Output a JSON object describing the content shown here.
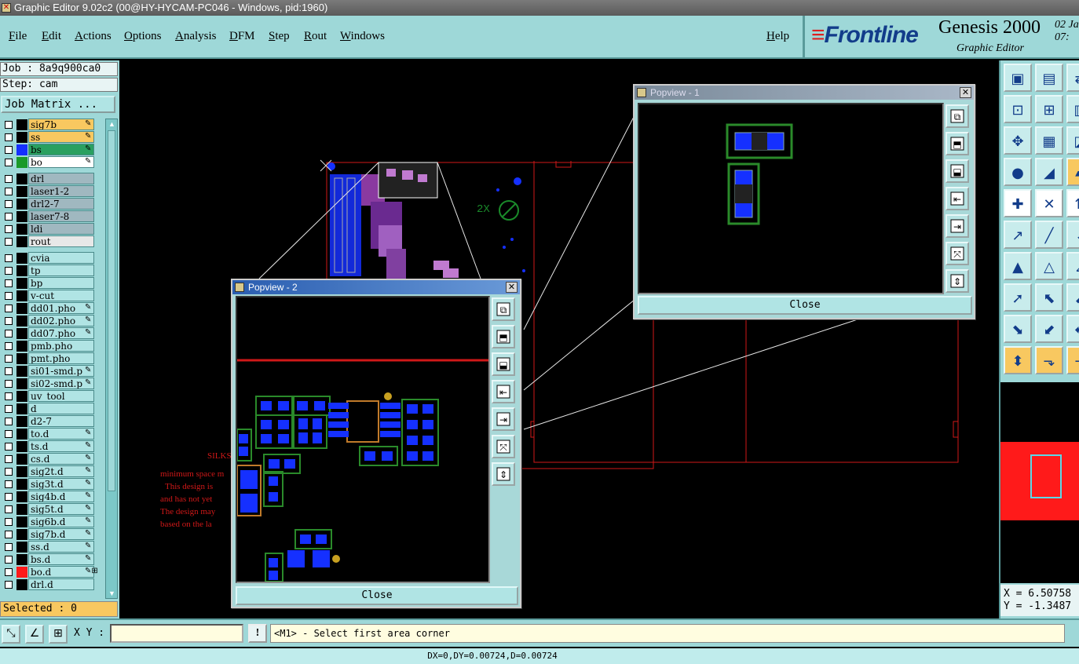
{
  "window": {
    "title": "Graphic Editor 9.02c2 (00@HY-HYCAM-PC046 - Windows, pid:1960)"
  },
  "menu": {
    "items": [
      "File",
      "Edit",
      "Actions",
      "Options",
      "Analysis",
      "DFM",
      "Step",
      "Rout",
      "Windows"
    ],
    "help": "Help"
  },
  "brand": {
    "logo": "Frontline",
    "product": "Genesis 2000",
    "subtitle": "Graphic Editor",
    "date_line1": "02  Ja",
    "date_line2": "07:"
  },
  "job": {
    "job_label": "Job : 8a9q900ca0",
    "step_label": "Step: cam",
    "matrix_button": "Job Matrix ..."
  },
  "layers": [
    {
      "name": "sig7b",
      "bg": "#f8c860",
      "swatch": "#000",
      "icon": "✎"
    },
    {
      "name": "ss",
      "bg": "#f8c860",
      "swatch": "#000",
      "icon": "✎"
    },
    {
      "name": "bs",
      "bg": "#2aa060",
      "swatch": "#1530ff",
      "icon": "✎"
    },
    {
      "name": "bo",
      "bg": "#ffffff",
      "swatch": "#1a9a2a",
      "icon": "✎"
    },
    {
      "name": "drl",
      "bg": "#a0b8c0",
      "swatch": "#000",
      "icon": ""
    },
    {
      "name": "laser1-2",
      "bg": "#a0b8c0",
      "swatch": "#000",
      "icon": ""
    },
    {
      "name": "drl2-7",
      "bg": "#a0b8c0",
      "swatch": "#000",
      "icon": ""
    },
    {
      "name": "laser7-8",
      "bg": "#a0b8c0",
      "swatch": "#000",
      "icon": ""
    },
    {
      "name": "ldi",
      "bg": "#a0b8c0",
      "swatch": "#000",
      "icon": ""
    },
    {
      "name": "rout",
      "bg": "#e8e8e8",
      "swatch": "#000",
      "icon": ""
    },
    {
      "name": "cvia",
      "bg": "#b0e4e4",
      "swatch": "#000",
      "icon": ""
    },
    {
      "name": "tp",
      "bg": "#b0e4e4",
      "swatch": "#000",
      "icon": ""
    },
    {
      "name": "bp",
      "bg": "#b0e4e4",
      "swatch": "#000",
      "icon": ""
    },
    {
      "name": "v-cut",
      "bg": "#b0e4e4",
      "swatch": "#000",
      "icon": ""
    },
    {
      "name": "dd01.pho",
      "bg": "#b0e4e4",
      "swatch": "#000",
      "icon": "✎"
    },
    {
      "name": "dd02.pho",
      "bg": "#b0e4e4",
      "swatch": "#000",
      "icon": "✎"
    },
    {
      "name": "dd07.pho",
      "bg": "#b0e4e4",
      "swatch": "#000",
      "icon": "✎"
    },
    {
      "name": "pmb.pho",
      "bg": "#b0e4e4",
      "swatch": "#000",
      "icon": ""
    },
    {
      "name": "pmt.pho",
      "bg": "#b0e4e4",
      "swatch": "#000",
      "icon": ""
    },
    {
      "name": "si01-smd.p",
      "bg": "#b0e4e4",
      "swatch": "#000",
      "icon": "✎"
    },
    {
      "name": "si02-smd.p",
      "bg": "#b0e4e4",
      "swatch": "#000",
      "icon": "✎"
    },
    {
      "name": "uv_tool",
      "bg": "#b0e4e4",
      "swatch": "#000",
      "icon": ""
    },
    {
      "name": "d",
      "bg": "#b0e4e4",
      "swatch": "#000",
      "icon": ""
    },
    {
      "name": "d2-7",
      "bg": "#b0e4e4",
      "swatch": "#000",
      "icon": ""
    },
    {
      "name": "to.d",
      "bg": "#b0e4e4",
      "swatch": "#000",
      "icon": "✎"
    },
    {
      "name": "ts.d",
      "bg": "#b0e4e4",
      "swatch": "#000",
      "icon": "✎"
    },
    {
      "name": "cs.d",
      "bg": "#b0e4e4",
      "swatch": "#000",
      "icon": "✎"
    },
    {
      "name": "sig2t.d",
      "bg": "#b0e4e4",
      "swatch": "#000",
      "icon": "✎"
    },
    {
      "name": "sig3t.d",
      "bg": "#b0e4e4",
      "swatch": "#000",
      "icon": "✎"
    },
    {
      "name": "sig4b.d",
      "bg": "#b0e4e4",
      "swatch": "#000",
      "icon": "✎"
    },
    {
      "name": "sig5t.d",
      "bg": "#b0e4e4",
      "swatch": "#000",
      "icon": "✎"
    },
    {
      "name": "sig6b.d",
      "bg": "#b0e4e4",
      "swatch": "#000",
      "icon": "✎"
    },
    {
      "name": "sig7b.d",
      "bg": "#b0e4e4",
      "swatch": "#000",
      "icon": "✎"
    },
    {
      "name": "ss.d",
      "bg": "#b0e4e4",
      "swatch": "#000",
      "icon": "✎"
    },
    {
      "name": "bs.d",
      "bg": "#b0e4e4",
      "swatch": "#000",
      "icon": "✎"
    },
    {
      "name": "bo.d",
      "bg": "#b0e4e4",
      "swatch": "#ff1a1a",
      "icon": "✎⊞"
    },
    {
      "name": "drl.d",
      "bg": "#b0e4e4",
      "swatch": "#000",
      "icon": ""
    }
  ],
  "selection": {
    "label": "Selected : 0"
  },
  "canvas": {
    "silkscreen_lines": [
      "SILKS",
      "minimum space m",
      "This design is",
      "and has not yet",
      "The design may",
      "based on the la"
    ],
    "marker_2x": "2X"
  },
  "popview1": {
    "title": "Popview - 1",
    "close_label": "Close"
  },
  "popview2": {
    "title": "Popview - 2",
    "close_label": "Close"
  },
  "bottom": {
    "xy_label": "X Y :",
    "xy_value": "",
    "warn_icon": "!",
    "prompt": "<M1> - Select first area corner"
  },
  "status": {
    "text": "DX=0,DY=0.00724,D=0.00724"
  },
  "coords": {
    "x": "X = 6.50758",
    "y": "Y = -1.3487"
  },
  "colors": {
    "panel": "#9ed8d8",
    "accent": "#f8c860",
    "title_active": "#2a5db0",
    "board_outline": "#e01010",
    "pad": "#1530ff",
    "pad_outline": "#1a9a2a"
  }
}
